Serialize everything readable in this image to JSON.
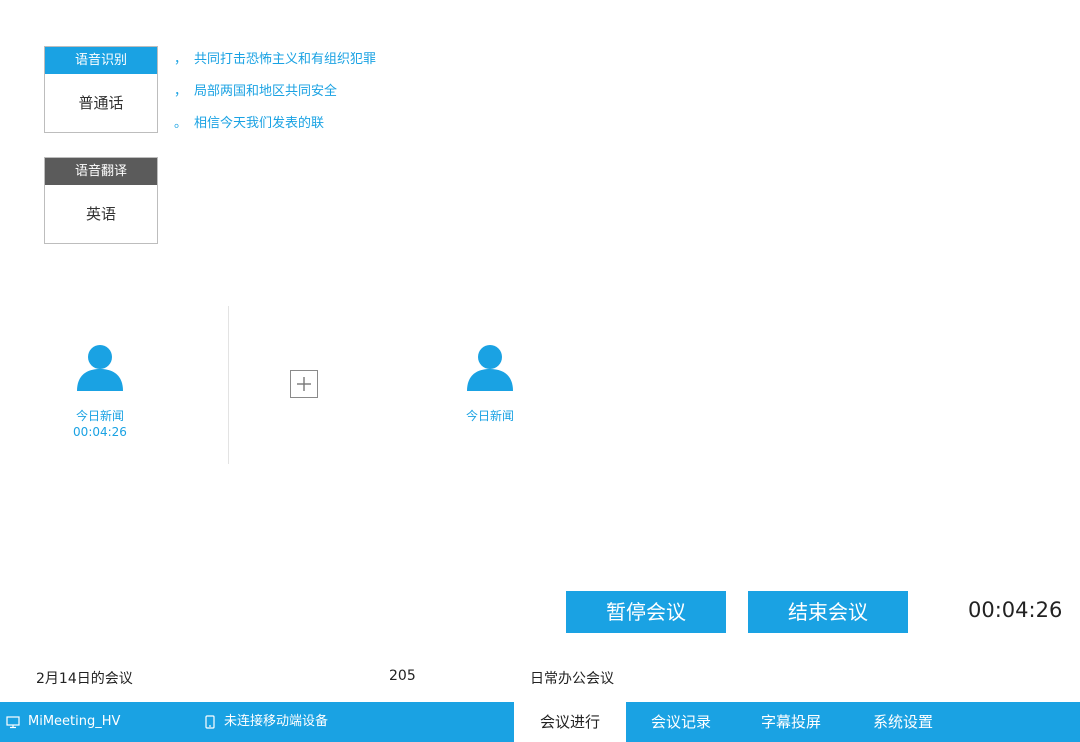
{
  "speech_recognition": {
    "header": "语音识别",
    "value": "普通话"
  },
  "speech_translation": {
    "header": "语音翻译",
    "value": "英语"
  },
  "transcript": [
    {
      "punct": "，",
      "text": "共同打击恐怖主义和有组织犯罪"
    },
    {
      "punct": "，",
      "text": "局部两国和地区共同安全"
    },
    {
      "punct": "。",
      "text": "相信今天我们发表的联"
    }
  ],
  "participants": [
    {
      "name": "今日新闻",
      "time": "00:04:26"
    },
    {
      "name": "今日新闻"
    }
  ],
  "actions": {
    "pause_label": "暂停会议",
    "end_label": "结束会议"
  },
  "timer": "00:04:26",
  "meeting": {
    "name": "2月14日的会议",
    "room": "205",
    "type": "日常办公会议"
  },
  "statusbar": {
    "device": "MiMeeting_HV",
    "mobile_status": "未连接移动端设备"
  },
  "tabs": [
    {
      "label": "会议进行",
      "active": true
    },
    {
      "label": "会议记录",
      "active": false
    },
    {
      "label": "字幕投屏",
      "active": false
    },
    {
      "label": "系统设置",
      "active": false
    }
  ],
  "colors": {
    "accent": "#1aa2e3",
    "dark_header": "#5b5b5b"
  },
  "icons": [
    "monitor-icon",
    "phone-icon",
    "user-avatar-icon",
    "plus-icon"
  ]
}
